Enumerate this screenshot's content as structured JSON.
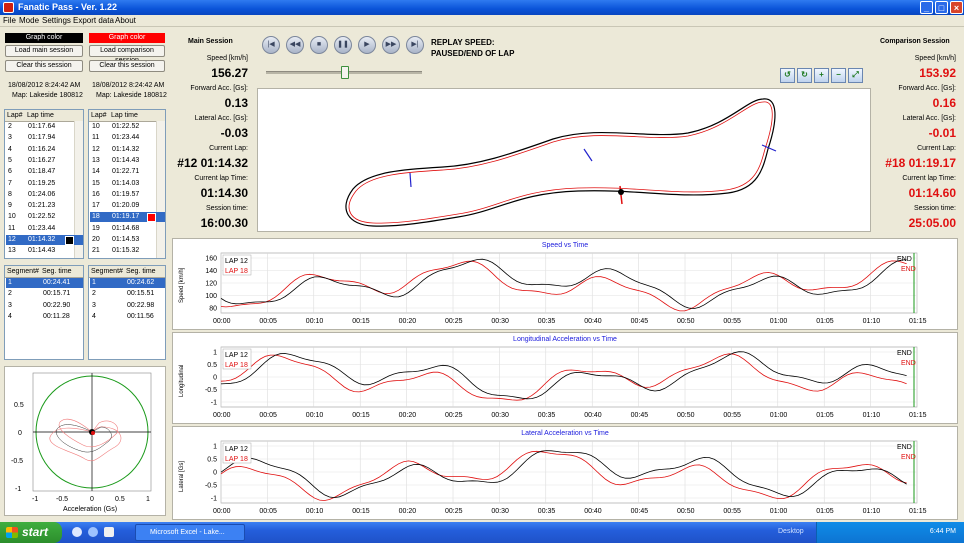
{
  "window": {
    "title": "Fanatic Pass - Ver. 1.22"
  },
  "menu": [
    "File",
    "Mode",
    "Settings",
    "Export data",
    "About"
  ],
  "main_controls": {
    "graph_color_label": "Graph color",
    "load_label": "Load main session",
    "clear_label": "Clear this session",
    "date": "18/08/2012 8:24:42 AM",
    "map": "Map: Lakeside 180812",
    "color": "#000000"
  },
  "comp_controls": {
    "graph_color_label": "Graph color",
    "load_label": "Load comparison session",
    "clear_label": "Clear this session",
    "date": "18/08/2012 8:24:42 AM",
    "map": "Map: Lakeside 180812",
    "color": "#ff0000"
  },
  "main_laps": {
    "headers": [
      "Lap#",
      "Lap time"
    ],
    "rows": [
      [
        "2",
        "01:17.64"
      ],
      [
        "3",
        "01:17.94"
      ],
      [
        "4",
        "01:16.24"
      ],
      [
        "5",
        "01:16.27"
      ],
      [
        "6",
        "01:18.47"
      ],
      [
        "7",
        "01:19.25"
      ],
      [
        "8",
        "01:24.06"
      ],
      [
        "9",
        "01:21.23"
      ],
      [
        "10",
        "01:22.52"
      ],
      [
        "11",
        "01:23.44"
      ],
      [
        "12",
        "01:14.32"
      ],
      [
        "13",
        "01:14.43"
      ]
    ],
    "selected_index": 10
  },
  "comp_laps": {
    "headers": [
      "Lap#",
      "Lap time"
    ],
    "rows": [
      [
        "10",
        "01:22.52"
      ],
      [
        "11",
        "01:23.44"
      ],
      [
        "12",
        "01:14.32"
      ],
      [
        "13",
        "01:14.43"
      ],
      [
        "14",
        "01:22.71"
      ],
      [
        "15",
        "01:14.03"
      ],
      [
        "16",
        "01:19.57"
      ],
      [
        "17",
        "01:20.09"
      ],
      [
        "18",
        "01:19.17"
      ],
      [
        "19",
        "01:14.68"
      ],
      [
        "20",
        "01:14.53"
      ],
      [
        "21",
        "01:15.32"
      ]
    ],
    "selected_index": 8
  },
  "main_segments": {
    "headers": [
      "Segment#",
      "Seg. time"
    ],
    "rows": [
      [
        "1",
        "00:24.41"
      ],
      [
        "2",
        "00:15.71"
      ],
      [
        "3",
        "00:22.90"
      ],
      [
        "4",
        "00:11.28"
      ]
    ],
    "selected_index": 0
  },
  "comp_segments": {
    "headers": [
      "Segment#",
      "Seg. time"
    ],
    "rows": [
      [
        "1",
        "00:24.62"
      ],
      [
        "2",
        "00:15.51"
      ],
      [
        "3",
        "00:22.98"
      ],
      [
        "4",
        "00:11.56"
      ]
    ],
    "selected_index": 0
  },
  "gg_plot": {
    "xlabel": "Acceleration (Gs)",
    "x_ticks": [
      "-1",
      "-0.5",
      "0",
      "0.5",
      "1"
    ],
    "y_ticks": [
      "1",
      "0.5",
      "0",
      "-0.5",
      "-1"
    ]
  },
  "main_session": {
    "title": "Main Session",
    "speed_label": "Speed [km/h]",
    "speed": "156.27",
    "fwd_label": "Forward Acc. [Gs]:",
    "fwd": "0.13",
    "lat_label": "Lateral Acc. [Gs]:",
    "lat": "-0.03",
    "curlap_label": "Current Lap:",
    "curlap": "#12 01:14.32",
    "laptime_label": "Current lap Time:",
    "laptime": "01:14.30",
    "sesstime_label": "Session time:",
    "sesstime": "16:00.30"
  },
  "comp_session": {
    "title": "Comparison Session",
    "speed_label": "Speed [km/h]",
    "speed": "153.92",
    "fwd_label": "Forward Acc. [Gs]:",
    "fwd": "0.16",
    "lat_label": "Lateral Acc. [Gs]:",
    "lat": "-0.01",
    "curlap_label": "Current Lap:",
    "curlap": "#18 01:19.17",
    "laptime_label": "Current lap Time:",
    "laptime": "01:14.60",
    "sesstime_label": "Session time:",
    "sesstime": "25:05.00"
  },
  "replay": {
    "label": "REPLAY SPEED:",
    "status": "PAUSED/END OF LAP",
    "buttons": [
      "skip-back",
      "rewind",
      "stop",
      "pause",
      "play",
      "fast-forward",
      "skip-forward"
    ],
    "slider_fraction": 0.5
  },
  "graphs": {
    "time_ticks": [
      "00:00",
      "00:05",
      "00:10",
      "00:15",
      "00:20",
      "00:25",
      "00:30",
      "00:35",
      "00:40",
      "00:45",
      "00:50",
      "00:55",
      "01:00",
      "01:05",
      "01:10",
      "01:15"
    ],
    "legend_main": "LAP 12",
    "legend_comp": "LAP 18",
    "end_label": "END",
    "speed": {
      "title": "Speed vs Time",
      "ylabel": "Speed [km/h]",
      "y_ticks": [
        "160",
        "140",
        "120",
        "100",
        "80"
      ]
    },
    "long": {
      "title": "Longitudinal Acceleration vs Time",
      "ylabel": "Longitudinal",
      "y_ticks": [
        "1",
        "0.5",
        "0",
        "-0.5",
        "-1"
      ]
    },
    "lat": {
      "title": "Lateral Acceleration vs Time",
      "ylabel": "Lateral [Gs]",
      "y_ticks": [
        "1",
        "0.5",
        "0",
        "-0.5",
        "-1"
      ]
    }
  },
  "taskbar": {
    "start_label": "start",
    "task_label": "Microsoft Excel - Lake...",
    "desktop_label": "Desktop",
    "clock": "6:44 PM"
  }
}
